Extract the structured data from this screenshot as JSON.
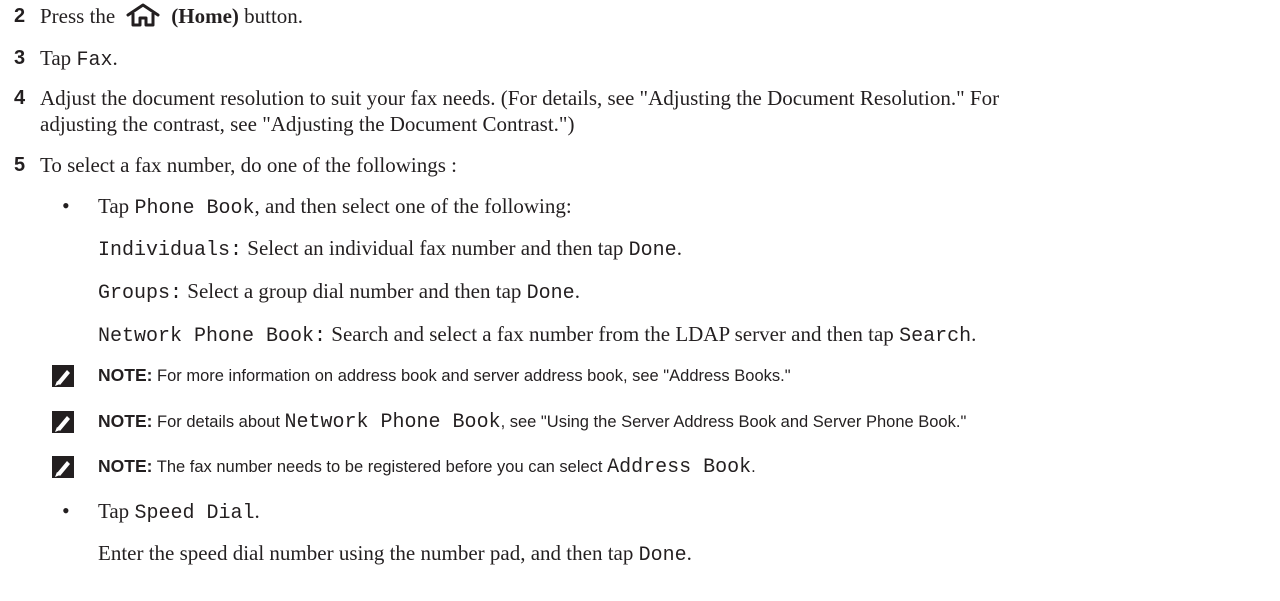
{
  "steps": [
    {
      "number": "2",
      "parts": [
        "Press the",
        "(Home)",
        "button."
      ],
      "icon": "home-icon"
    },
    {
      "number": "3",
      "text": "Tap ",
      "mono": "Fax",
      "end": "."
    },
    {
      "number": "4",
      "line1": "Adjust the document resolution to suit your fax needs. (For details, see \"Adjusting the Document Resolution.\" For",
      "line2": "adjusting the contrast, see \"Adjusting the Document Contrast.\")"
    },
    {
      "number": "5",
      "text": "To select a fax number, do one of the followings :"
    }
  ],
  "bullet1": {
    "bullet": "•",
    "pre": "Tap ",
    "mono": "Phone Book",
    "post": ", and then select one of the following:",
    "options": [
      {
        "mono": "Individuals:",
        "text": " Select an individual fax number and then tap ",
        "mono2": "Done",
        "end": "."
      },
      {
        "mono": "Groups:",
        "text": " Select a group dial number and then tap ",
        "mono2": "Done",
        "end": "."
      },
      {
        "mono": "Network Phone Book:",
        "text": " Search and select a fax number from the LDAP server and then tap ",
        "mono2": "Search",
        "end": "."
      }
    ]
  },
  "notes": [
    {
      "label": "NOTE:",
      "text": " For more information on address book and server address book, see \"Address Books.\""
    },
    {
      "label": "NOTE:",
      "pre": " For details about ",
      "mono": "Network Phone Book",
      "post": ", see \"Using the Server Address Book and Server Phone Book.\""
    },
    {
      "label": "NOTE:",
      "pre": " The fax number needs to be registered before you can select ",
      "mono": "Address Book",
      "post": "."
    }
  ],
  "bullet2": {
    "bullet": "•",
    "pre": "Tap ",
    "mono": "Speed Dial",
    "post": ".",
    "line2_pre": "Enter the speed dial number using the number pad, and then tap ",
    "line2_mono": "Done",
    "line2_post": "."
  },
  "icons": {
    "home": "home-icon",
    "note": "pencil-note-icon"
  }
}
